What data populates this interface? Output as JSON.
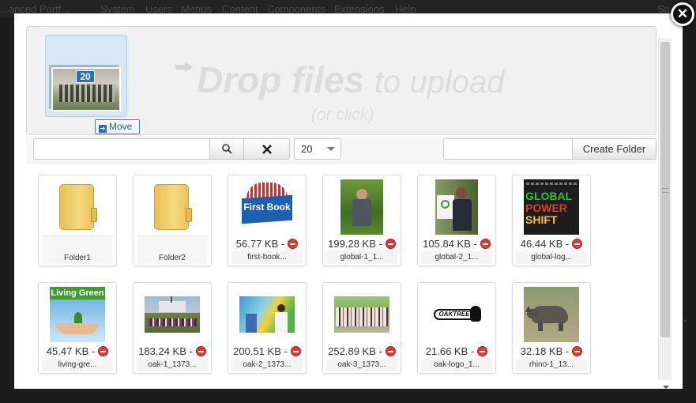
{
  "backdrop": {
    "site_title": "...anced Portf...",
    "nav": [
      "System",
      "Users",
      "Menus",
      "Content",
      "Components",
      "Extensions",
      "Help"
    ],
    "right_text": "Su"
  },
  "modal": {
    "close_symbol": "✕"
  },
  "dropzone": {
    "title_bold": "Drop files",
    "title_light": "to upload",
    "subtitle": "(or click)",
    "drag_count": "20",
    "move_label": "Move"
  },
  "toolbar": {
    "search_value": "",
    "search_icon": "search-icon",
    "clear_icon": "close-icon",
    "limit_value": "20",
    "folder_name_value": "",
    "create_folder_label": "Create Folder"
  },
  "folders": [
    {
      "name": "Folder1"
    },
    {
      "name": "Folder2"
    }
  ],
  "files": [
    {
      "size": "56.77 KB -",
      "name": "first-book...",
      "thumb": "first-book"
    },
    {
      "size": "199.28 KB -",
      "name": "global-1_1...",
      "thumb": "global-1"
    },
    {
      "size": "105.84 KB -",
      "name": "global-2_1...",
      "thumb": "global-2"
    },
    {
      "size": "46.44 KB -",
      "name": "global-log...",
      "thumb": "global-logo"
    },
    {
      "size": "45.47 KB -",
      "name": "living-gre...",
      "thumb": "living-green"
    },
    {
      "size": "183.24 KB -",
      "name": "oak-1_1373...",
      "thumb": "oak-1"
    },
    {
      "size": "200.51 KB -",
      "name": "oak-2_1373...",
      "thumb": "oak-2"
    },
    {
      "size": "252.89 KB -",
      "name": "oak-3_1373...",
      "thumb": "oak-3"
    },
    {
      "size": "21.66 KB -",
      "name": "oak-logo_1...",
      "thumb": "oak-logo"
    },
    {
      "size": "32.18 KB -",
      "name": "rhino-1_13...",
      "thumb": "rhino-1"
    }
  ],
  "thumb_text": {
    "first_book": "First Book",
    "global_power": [
      "GLOBAL",
      "POWER",
      "SHIFT"
    ],
    "living_green": "Living Green",
    "oaktree": "OAKTREE"
  }
}
